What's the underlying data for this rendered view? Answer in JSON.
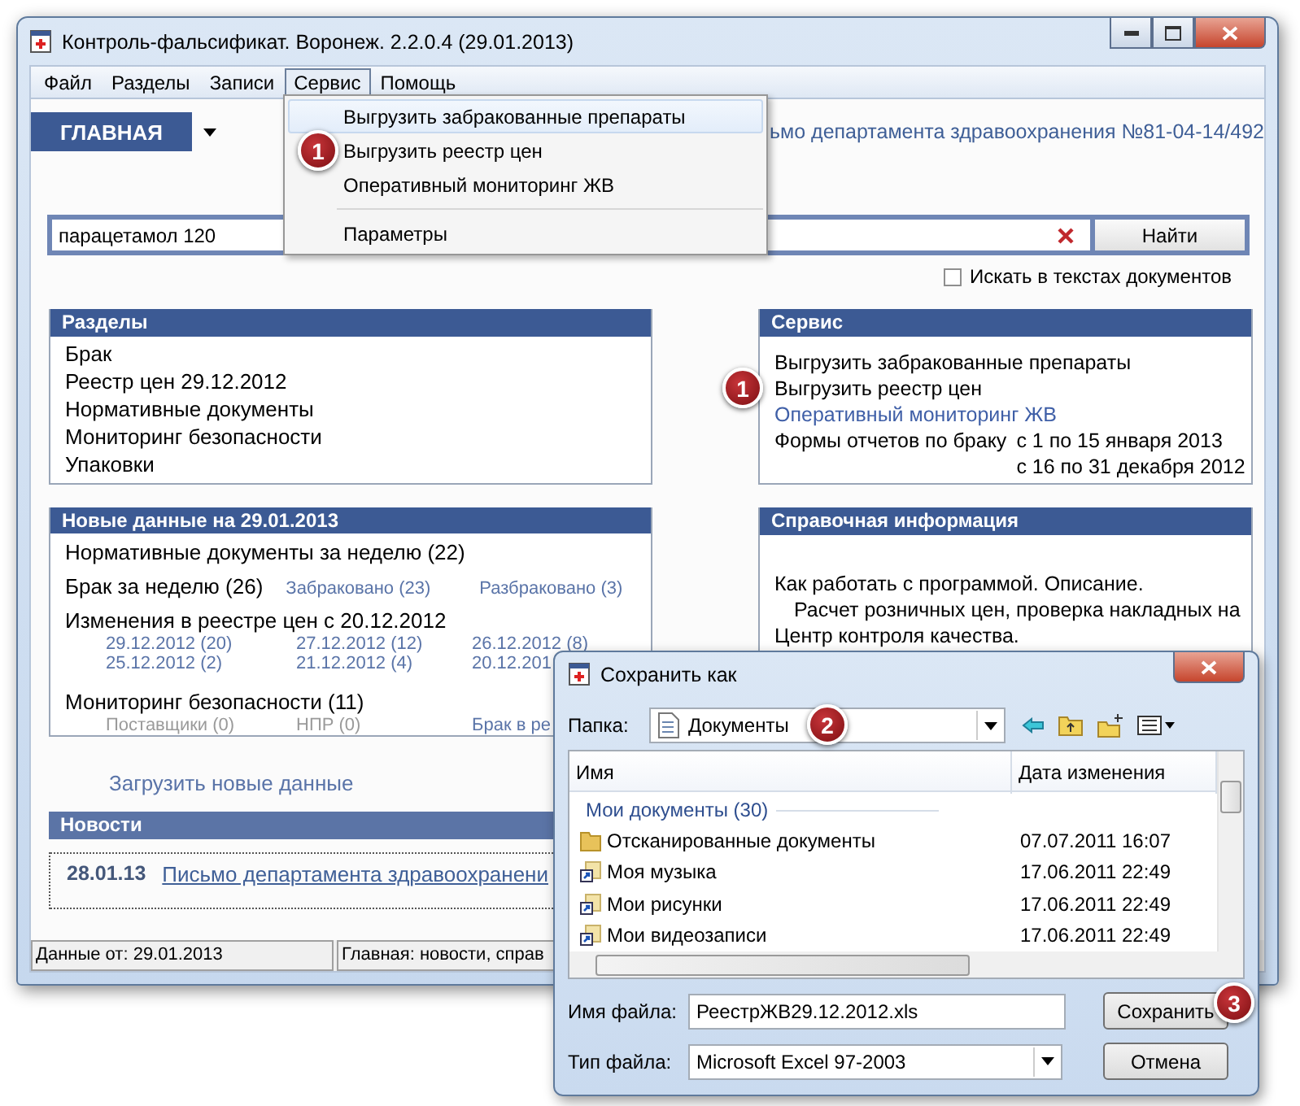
{
  "window": {
    "title": "Контроль-фальсификат. Воронеж. 2.2.0.4 (29.01.2013)"
  },
  "menu": [
    {
      "label": "Файл",
      "selected": false
    },
    {
      "label": "Разделы",
      "selected": false
    },
    {
      "label": "Записи",
      "selected": false
    },
    {
      "label": "Сервис",
      "selected": true
    },
    {
      "label": "Помощь",
      "selected": false
    }
  ],
  "dropdown": [
    {
      "kind": "item",
      "label": "Выгрузить забракованные препараты",
      "selected": true
    },
    {
      "kind": "item",
      "label": "Выгрузить реестр цен",
      "selected": false,
      "badge": "1"
    },
    {
      "kind": "item",
      "label": "Оперативный мониторинг ЖВ",
      "selected": false
    },
    {
      "kind": "separator"
    },
    {
      "kind": "item",
      "label": "Параметры",
      "selected": false
    }
  ],
  "home_tab": {
    "label": "ГЛАВНАЯ"
  },
  "news_ticker": "ьмо департамента здравоохранения №81-04-14/492",
  "search": {
    "value": "парацетамол 120",
    "button": "Найти"
  },
  "search_in_docs": {
    "label": "Искать в текстах документов",
    "checked": false
  },
  "sections_panel": {
    "title": "Разделы",
    "items": [
      "Брак",
      "Реестр цен 29.12.2012",
      "Нормативные документы",
      "Мониторинг безопасности",
      "Упаковки"
    ]
  },
  "service_panel": {
    "title": "Сервис",
    "items": [
      {
        "kind": "text",
        "label": "Выгрузить забракованные препараты"
      },
      {
        "kind": "text",
        "label": "Выгрузить реестр цен",
        "badge": "1"
      },
      {
        "kind": "link",
        "label": "Оперативный мониторинг ЖВ"
      },
      {
        "kind": "forms",
        "label": "Формы отчетов по браку",
        "dates": [
          "с 1 по 15 января 2013",
          "с 16 по 31 декабря 2012"
        ]
      }
    ]
  },
  "new_data_panel": {
    "title": "Новые данные на 29.01.2013",
    "groups": [
      {
        "kind": "plain",
        "label": "Нормативные документы за неделю (22)"
      },
      {
        "kind": "inline",
        "label": "Брак за неделю (26)",
        "links": [
          {
            "label": "Забраковано (23)",
            "disabled": false
          },
          {
            "label": "Разбраковано (3)",
            "disabled": false
          }
        ]
      },
      {
        "kind": "grid",
        "label": "Изменения в реестре цен с 20.12.2012",
        "links": [
          {
            "label": "29.12.2012 (20)",
            "disabled": false
          },
          {
            "label": "27.12.2012 (12)",
            "disabled": false
          },
          {
            "label": "26.12.2012 (8)",
            "disabled": false
          },
          {
            "label": "25.12.2012 (2)",
            "disabled": false
          },
          {
            "label": "21.12.2012 (4)",
            "disabled": false
          },
          {
            "label": "20.12.201",
            "disabled": false
          }
        ]
      },
      {
        "kind": "grid",
        "label": "Мониторинг безопасности (11)",
        "links": [
          {
            "label": "Поставщики (0)",
            "disabled": true
          },
          {
            "label": "НПР (0)",
            "disabled": true
          },
          {
            "label": "Брак в ре",
            "disabled": false
          }
        ]
      }
    ]
  },
  "reference_panel": {
    "title": "Справочная информация",
    "items": [
      {
        "label": "Как работать с программой. Описание.",
        "indented": false
      },
      {
        "label": "Расчет розничных цен, проверка накладных на",
        "indented": true
      },
      {
        "label": "Центр контроля качества.",
        "indented": false
      }
    ]
  },
  "load_link": "Загрузить новые данные",
  "news": {
    "title": "Новости",
    "items": [
      {
        "date": "28.01.13",
        "text": "Письмо департамента здравоохранени"
      }
    ]
  },
  "status_bar": [
    "Данные от: 29.01.2013",
    "Главная: новости, справ"
  ],
  "dialog": {
    "title": "Сохранить как",
    "folder_label": "Папка:",
    "folder": "Документы",
    "folder_badge": "2",
    "columns": [
      "Имя",
      "Дата изменения"
    ],
    "group": "Мои документы (30)",
    "files": [
      {
        "kind": "folder",
        "name": "Отсканированные документы",
        "date": "07.07.2011 16:07"
      },
      {
        "kind": "shortcut",
        "name": "Моя музыка",
        "date": "17.06.2011 22:49"
      },
      {
        "kind": "shortcut",
        "name": "Мои рисунки",
        "date": "17.06.2011 22:49"
      },
      {
        "kind": "shortcut",
        "name": "Мои видеозаписи",
        "date": "17.06.2011 22:49"
      }
    ],
    "filename_label": "Имя файла:",
    "filename": "РеестрЖВ29.12.2012.xls",
    "type_label": "Тип файла:",
    "type": "Microsoft Excel 97-2003",
    "save": "Сохранить",
    "save_badge": "3",
    "cancel": "Отмена"
  }
}
